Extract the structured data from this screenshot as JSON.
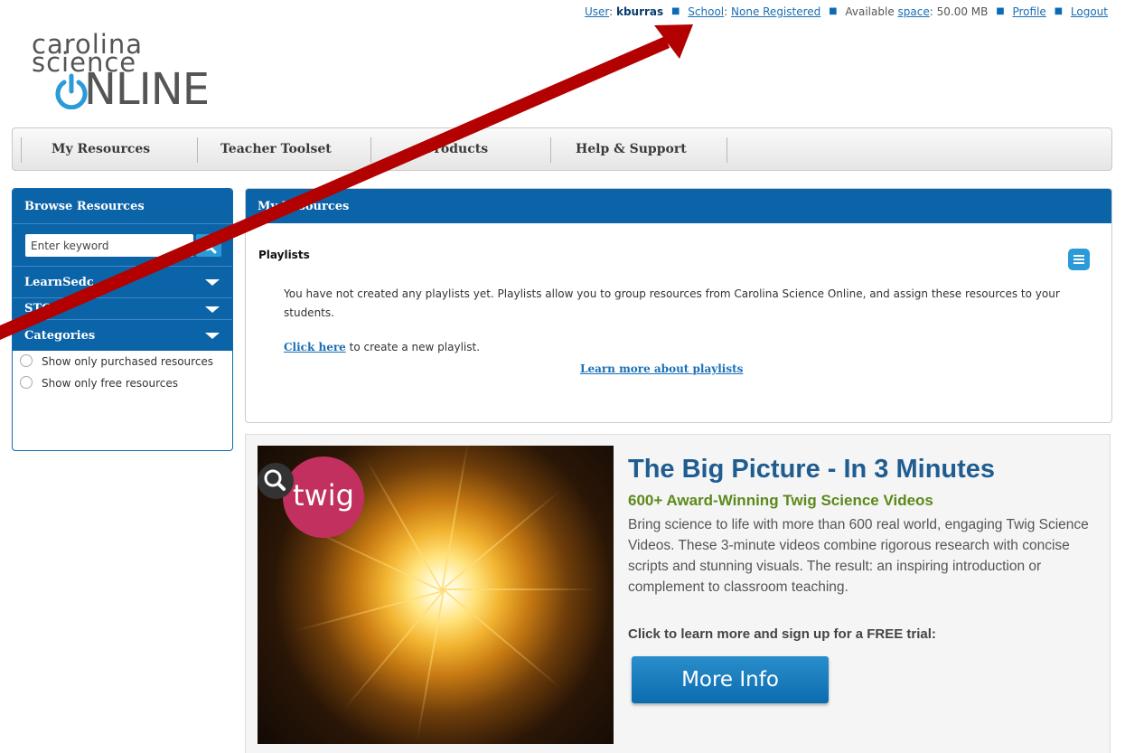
{
  "userbar": {
    "user_label": "User",
    "user_sep": ":",
    "user_name": "kburras",
    "school_label": "School",
    "school_sep": ":",
    "school_value": "None Registered",
    "space_prefix": "Available",
    "space_link": "space",
    "space_value": ": 50.00 MB",
    "profile": "Profile",
    "logout": "Logout",
    "bullet": "■"
  },
  "logo": {
    "line1": "carolina",
    "line2": "science",
    "line3": "NLINE"
  },
  "nav": {
    "items": [
      {
        "label": "My Resources"
      },
      {
        "label": "Teacher Toolset"
      },
      {
        "label": "Products"
      },
      {
        "label": "Help & Support"
      }
    ]
  },
  "sidebar": {
    "title": "Browse Resources",
    "search_placeholder": "Enter keyword",
    "filters": [
      {
        "label": "LearnSedc"
      },
      {
        "label": "STC"
      },
      {
        "label": "Categories"
      }
    ],
    "checks": [
      {
        "label": "Show only purchased resources"
      },
      {
        "label": "Show only free resources"
      }
    ]
  },
  "panel": {
    "title": "My Resources",
    "playlists_title": "Playlists",
    "message": "You have not created any playlists yet. Playlists allow you to group resources from Carolina Science Online, and assign these resources to your students.",
    "click_link": "Click here",
    "click_rest": " to create a new playlist.",
    "learn_more": "Learn more about playlists"
  },
  "promo": {
    "badge": "twig",
    "title": "The Big Picture - In 3 Minutes",
    "subtitle": "600+ Award-Winning Twig Science Videos",
    "body": "Bring science to life with more than 600 real world, engaging Twig Science Videos. These 3-minute videos combine rigorous research with concise scripts and stunning visuals. The result: an inspiring introduction or complement to classroom teaching.",
    "cta": "Click to learn more and sign up for a FREE trial:",
    "button": "More Info"
  },
  "colors": {
    "brand_blue": "#0b63a8",
    "accent_blue": "#2b9ad8",
    "twig_pink": "#c2305f",
    "arrow_red": "#b30000"
  }
}
